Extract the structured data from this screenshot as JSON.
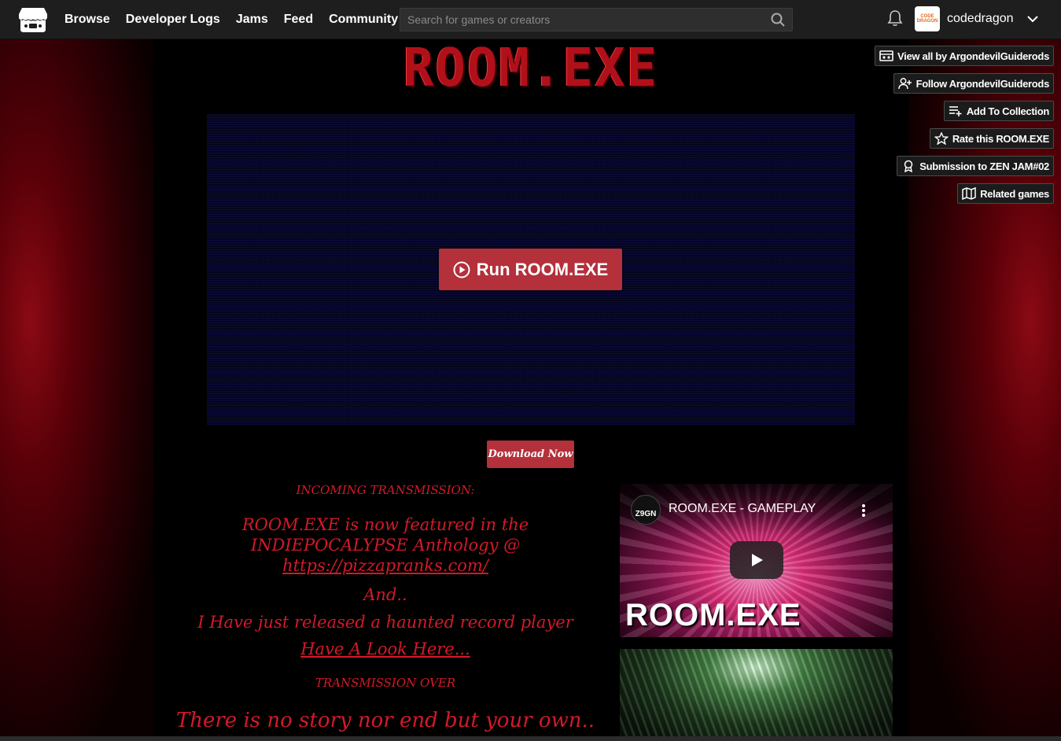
{
  "nav": {
    "logo_icon": "itchio-logo-icon",
    "links": [
      "Browse",
      "Developer Logs",
      "Jams",
      "Feed",
      "Community"
    ]
  },
  "search": {
    "placeholder": "Search for games or creators",
    "value": ""
  },
  "user": {
    "name": "codedragon",
    "avatar_text": "CODE DRAGON"
  },
  "game": {
    "title": "ROOM.EXE",
    "run_label": "Run ROOM.EXE",
    "download_label": "Download Now"
  },
  "actions": [
    {
      "label": "View all by ArgondevilGuiderods",
      "icon": "gallery-icon"
    },
    {
      "label": "Follow ArgondevilGuiderods",
      "icon": "add-user-icon"
    },
    {
      "label": "Add To Collection",
      "icon": "add-list-icon"
    },
    {
      "label": "Rate this ROOM.EXE",
      "icon": "star-icon"
    },
    {
      "label": "Submission to ZEN JAM#02",
      "icon": "award-icon"
    },
    {
      "label": "Related games",
      "icon": "map-icon"
    }
  ],
  "description": {
    "heading": "INCOMING TRANSMISSION:",
    "featured_prefix": "ROOM.EXE is now featured in the INDIEPOCALYPSE Anthology @ ",
    "featured_link": "https://pizzapranks.com/",
    "and": "And..",
    "released": "I Have just released a haunted record player",
    "look_link": "Have A Look Here...",
    "over": "TRANSMISSION OVER",
    "tagline": "There is no story nor end but your own.."
  },
  "video": {
    "channel": "Z9GN",
    "title": "ROOM.EXE - GAMEPLAY",
    "overlay_text": "ROOM.EXE"
  },
  "colors": {
    "accent_red": "#b4303b",
    "description_red": "#d21a28",
    "topbar": "#1e1e1e"
  }
}
